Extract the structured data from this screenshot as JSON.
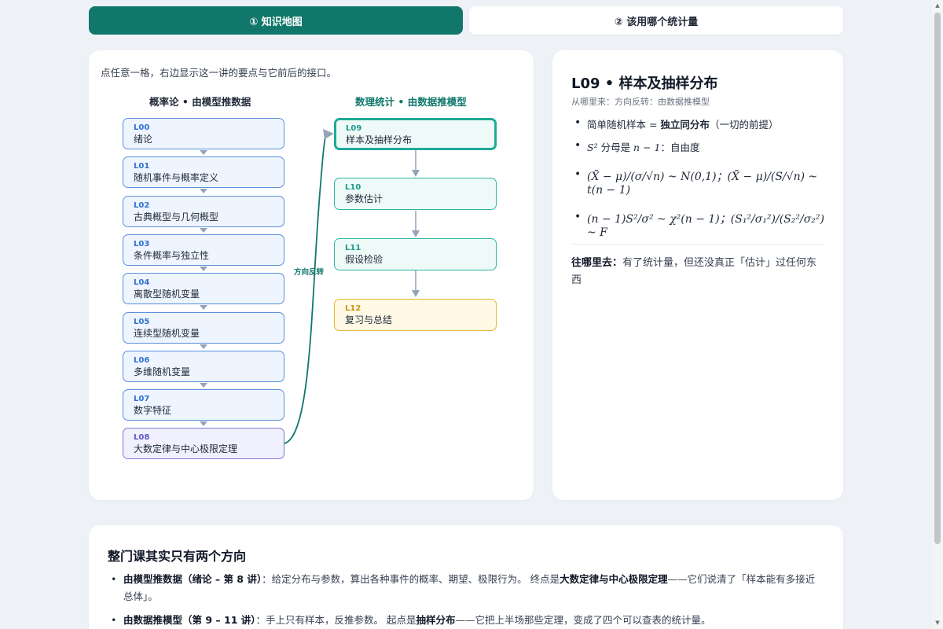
{
  "tabs": {
    "map": "① 知识地图",
    "which_stat": "② 该用哪个统计量"
  },
  "map": {
    "hint": "点任意一格，右边显示这一讲的要点与它前后的接口。",
    "left_title": "概率论 • 由模型推数据",
    "right_title": "数理统计 • 由数据推模型",
    "edge_label": "方向反转",
    "left_nodes": [
      {
        "code": "L00",
        "title": "绪论"
      },
      {
        "code": "L01",
        "title": "随机事件与概率定义"
      },
      {
        "code": "L02",
        "title": "古典概型与几何概型"
      },
      {
        "code": "L03",
        "title": "条件概率与独立性"
      },
      {
        "code": "L04",
        "title": "离散型随机变量"
      },
      {
        "code": "L05",
        "title": "连续型随机变量"
      },
      {
        "code": "L06",
        "title": "多维随机变量"
      },
      {
        "code": "L07",
        "title": "数字特征"
      },
      {
        "code": "L08",
        "title": "大数定律与中心极限定理"
      }
    ],
    "right_nodes": [
      {
        "code": "L09",
        "title": "样本及抽样分布"
      },
      {
        "code": "L10",
        "title": "参数估计"
      },
      {
        "code": "L11",
        "title": "假设检验"
      },
      {
        "code": "L12",
        "title": "复习与总结"
      }
    ],
    "colors": {
      "blue": "#5b8fd9",
      "purple": "#7b78d6",
      "teal": "#1faa98",
      "yellow": "#e4b62c",
      "accent": "#11776b"
    }
  },
  "detail": {
    "title": "L09 • 样本及抽样分布",
    "from": "从哪里来：方向反转：由数据推模型",
    "points": {
      "p1_a": "简单随机样本 = ",
      "p1_b": "独立同分布",
      "p1_c": "（一切的前提）",
      "p2_a": "S² ",
      "p2_b": "分母是 ",
      "p2_c": "n − 1",
      "p2_d": "：自由度",
      "p3": "(X̄ − μ)/(σ/√n) ~ N(0,1)；(X̄ − μ)/(S/√n) ~ t(n − 1)",
      "p4": "(n − 1)S²/σ² ~ χ²(n − 1)；(S₁²/σ₁²)/(S₂²/σ₂²) ~ F"
    },
    "next_label": "往哪里去：",
    "next_text": "有了统计量，但还没真正「估计」过任何东西"
  },
  "bottom": {
    "title": "整门课其实只有两个方向",
    "item1_label": "由模型推数据（绪论 – 第 8 讲）",
    "item1_text_a": "：给定分布与参数，算出各种事件的概率、期望、极限行为。 终点是",
    "item1_bold": "大数定律与中心极限定理",
    "item1_text_b": "——它们说清了「样本能有多接近总体」。",
    "item2_label": "由数据推模型（第 9 – 11 讲）",
    "item2_text_a": "：手上只有样本，反推参数。 起点是",
    "item2_bold": "抽样分布",
    "item2_text_b": "——它把上半场那些定理，变成了四个可以查表的统计量。"
  }
}
